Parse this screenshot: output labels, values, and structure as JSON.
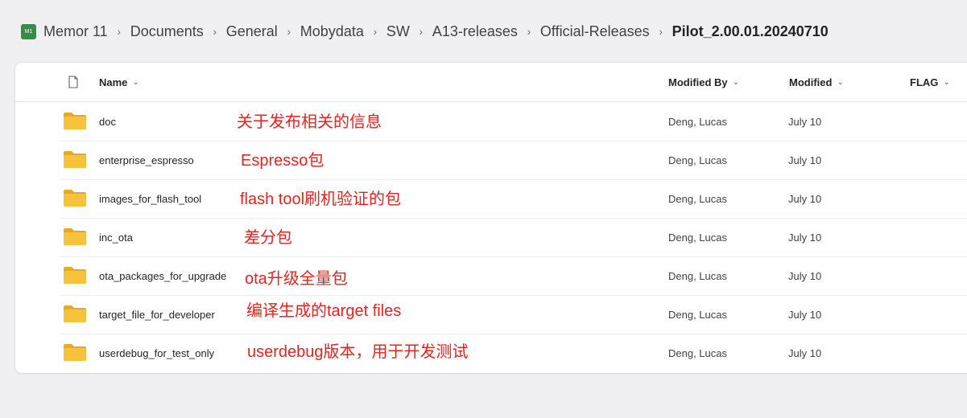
{
  "breadcrumb": {
    "site_icon_text": "M1",
    "items": [
      "Memor 11",
      "Documents",
      "General",
      "Mobydata",
      "SW",
      "A13-releases",
      "Official-Releases"
    ],
    "current": "Pilot_2.00.01.20240710",
    "separator": "›"
  },
  "table": {
    "columns": {
      "name": "Name",
      "modified_by": "Modified By",
      "modified": "Modified",
      "flag": "FLAG"
    },
    "rows": [
      {
        "name": "doc",
        "note": "关于发布相关的信息",
        "modified_by": "Deng, Lucas",
        "modified": "July 10"
      },
      {
        "name": "enterprise_espresso",
        "note": "Espresso包",
        "modified_by": "Deng, Lucas",
        "modified": "July 10"
      },
      {
        "name": "images_for_flash_tool",
        "note": "flash tool刷机验证的包",
        "modified_by": "Deng, Lucas",
        "modified": "July 10"
      },
      {
        "name": "inc_ota",
        "note": "差分包",
        "modified_by": "Deng, Lucas",
        "modified": "July 10"
      },
      {
        "name": "ota_packages_for_upgrade",
        "note": "ota升级全量包",
        "modified_by": "Deng, Lucas",
        "modified": "July 10"
      },
      {
        "name": "target_file_for_developer",
        "note": "编译生成的target files",
        "modified_by": "Deng, Lucas",
        "modified": "July 10"
      },
      {
        "name": "userdebug_for_test_only",
        "note": "userdebug版本，用于开发测试",
        "modified_by": "Deng, Lucas",
        "modified": "July 10"
      }
    ]
  },
  "colors": {
    "annotation": "#e8231f",
    "folder": "#f7c33c",
    "site_icon": "#3a8a4a"
  },
  "icons": {
    "folder": "folder-icon",
    "file_type": "file-type-icon",
    "chevron": "chevron-down-icon"
  }
}
